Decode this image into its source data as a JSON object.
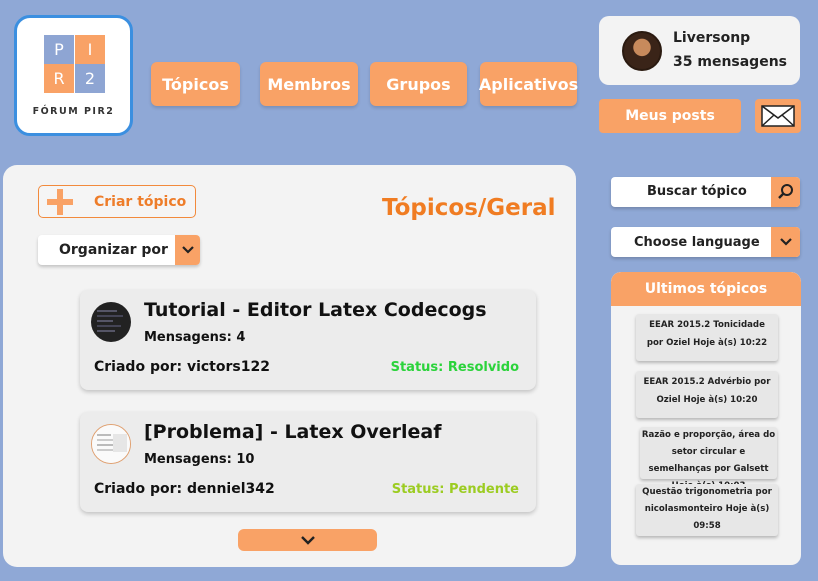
{
  "logo": {
    "letters": [
      "P",
      "I",
      "R",
      "2"
    ],
    "text": "FÓRUM PIR2",
    "colors": [
      "#8ea5d3",
      "#f9a266",
      "#f9a266",
      "#8ea5d3"
    ]
  },
  "nav": [
    {
      "label": "Tópicos"
    },
    {
      "label": "Membros"
    },
    {
      "label": "Grupos"
    },
    {
      "label": "Aplicativos"
    }
  ],
  "user": {
    "name": "Liversonp",
    "messages": "35 mensagens"
  },
  "my_posts_label": "Meus posts",
  "create_topic_label": "Criar tópico",
  "page_title": "Tópicos/Geral",
  "organize_label": "Organizar por",
  "topics": [
    {
      "title": "Tutorial - Editor Latex Codecogs",
      "messages": "Mensagens: 4",
      "author": "Criado por: victors122",
      "status": "Status: Resolvido",
      "status_color": "#2bd33b"
    },
    {
      "title": "[Problema] - Latex Overleaf",
      "messages": "Mensagens: 10",
      "author": "Criado por: denniel342",
      "status": "Status: Pendente",
      "status_color": "#9ccc22"
    }
  ],
  "search_label": "Buscar tópico",
  "language_label": "Choose language",
  "recent": {
    "title": "Ultimos tópicos",
    "items": [
      "EEAR 2015.2 Tonicidade por Oziel Hoje à(s) 10:22",
      "EEAR 2015.2 Advérbio por Oziel Hoje à(s) 10:20",
      "Razão e proporção, área do setor circular e semelhanças por Galsett Hoje à(s) 10:03",
      "Questão trigonometria por nicolasmonteiro Hoje à(s) 09:58"
    ]
  },
  "colors": {
    "background": "#8fa8d6",
    "accent": "#f9a266",
    "title": "#f07c22",
    "logo_border": "#3b8fe0"
  }
}
